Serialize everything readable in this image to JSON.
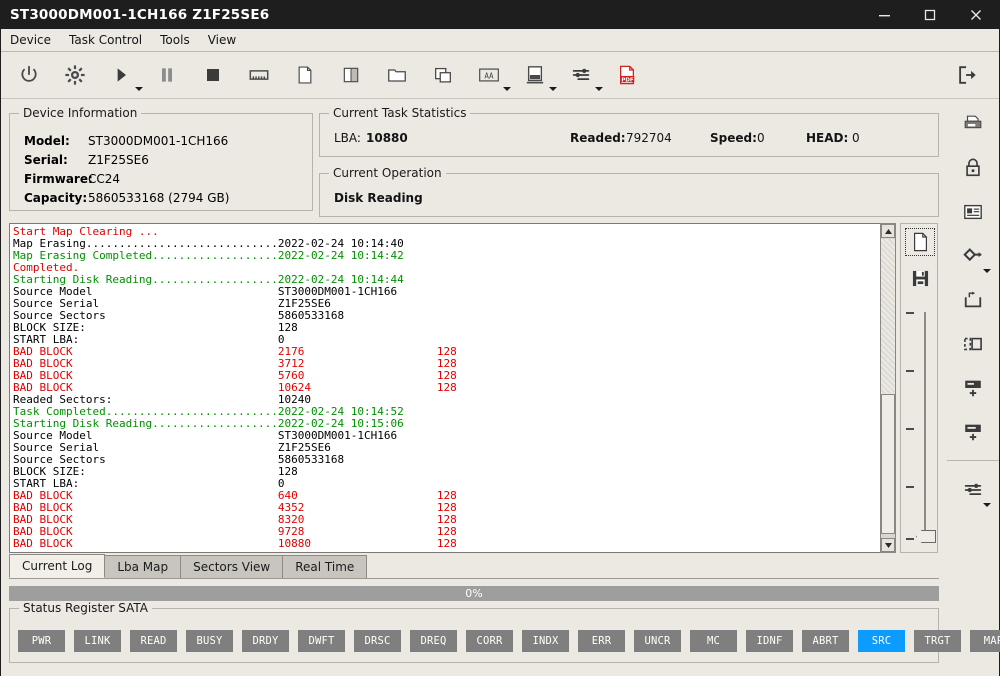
{
  "window": {
    "title": "ST3000DM001-1CH166 Z1F25SE6",
    "minimize": "minimize-icon",
    "maximize": "maximize-icon",
    "close": "close-icon"
  },
  "menu": {
    "items": [
      {
        "label": "Device"
      },
      {
        "label": "Task Control"
      },
      {
        "label": "Tools"
      },
      {
        "label": "View"
      }
    ]
  },
  "toolbar": {
    "buttons": [
      {
        "name": "power-icon",
        "caret": false
      },
      {
        "name": "gear-icon",
        "caret": false
      },
      {
        "name": "play-icon",
        "caret": true
      },
      {
        "name": "pause-icon",
        "caret": false
      },
      {
        "name": "stop-icon",
        "caret": false
      },
      {
        "name": "memory-chip-icon",
        "caret": false
      },
      {
        "name": "file-icon",
        "caret": false
      },
      {
        "name": "split-view-icon",
        "caret": false
      },
      {
        "name": "folder-icon",
        "caret": false
      },
      {
        "name": "copy-icon",
        "caret": false
      },
      {
        "name": "ascii-icon",
        "caret": true
      },
      {
        "name": "drive-icon",
        "caret": true
      },
      {
        "name": "sliders-icon",
        "caret": true
      },
      {
        "name": "pdf-icon",
        "caret": false
      }
    ],
    "exit": {
      "name": "exit-icon"
    }
  },
  "rail": {
    "buttons": [
      {
        "name": "print-icon",
        "caret": false
      },
      {
        "name": "lock-icon",
        "caret": false
      },
      {
        "name": "id-card-icon",
        "caret": false
      },
      {
        "name": "key-icon",
        "caret": true
      },
      {
        "name": "open-box-icon",
        "caret": false
      },
      {
        "name": "dashed-box-icon",
        "caret": false
      },
      {
        "name": "add-partition-icon",
        "caret": false
      },
      {
        "name": "add-bar-icon",
        "caret": false
      }
    ],
    "buttons_after_divider": [
      {
        "name": "sliders-icon",
        "caret": true
      }
    ]
  },
  "device_information": {
    "legend": "Device Information",
    "rows": [
      {
        "label": "Model:",
        "value": "ST3000DM001-1CH166"
      },
      {
        "label": "Serial:",
        "value": "Z1F25SE6"
      },
      {
        "label": "Firmware:",
        "value": "CC24"
      },
      {
        "label": "Capacity:",
        "value": "5860533168 (2794 GB)"
      }
    ]
  },
  "task_statistics": {
    "legend": "Current Task Statistics",
    "fields": [
      {
        "label": "LBA:",
        "value": "10880"
      },
      {
        "label": "Readed:",
        "value": "792704"
      },
      {
        "label": "Speed:",
        "value": "0"
      },
      {
        "label": "HEAD:",
        "value": "0"
      }
    ]
  },
  "current_operation": {
    "legend": "Current Operation",
    "value": "Disk Reading"
  },
  "log": {
    "lines": [
      {
        "color": "red",
        "text": "Start Map Clearing ..."
      },
      {
        "color": "black",
        "text": "Map Erasing.............................2022-02-24 10:14:40"
      },
      {
        "color": "green",
        "text": "Map Erasing Completed...................2022-02-24 10:14:42"
      },
      {
        "color": "red",
        "text": "Completed."
      },
      {
        "color": "green",
        "text": "Starting Disk Reading...................2022-02-24 10:14:44"
      },
      {
        "color": "black",
        "text": "Source Model                            ST3000DM001-1CH166"
      },
      {
        "color": "black",
        "text": "Source Serial                           Z1F25SE6"
      },
      {
        "color": "black",
        "text": "Source Sectors                          5860533168"
      },
      {
        "color": "black",
        "text": "BLOCK SIZE:                             128"
      },
      {
        "color": "black",
        "text": "START LBA:                              0"
      },
      {
        "color": "red",
        "text": "BAD BLOCK                               2176                    128"
      },
      {
        "color": "red",
        "text": "BAD BLOCK                               3712                    128"
      },
      {
        "color": "red",
        "text": "BAD BLOCK                               5760                    128"
      },
      {
        "color": "red",
        "text": "BAD BLOCK                               10624                   128"
      },
      {
        "color": "black",
        "text": "Readed Sectors:                         10240"
      },
      {
        "color": "green",
        "text": "Task Completed..........................2022-02-24 10:14:52"
      },
      {
        "color": "green",
        "text": "Starting Disk Reading...................2022-02-24 10:15:06"
      },
      {
        "color": "black",
        "text": "Source Model                            ST3000DM001-1CH166"
      },
      {
        "color": "black",
        "text": "Source Serial                           Z1F25SE6"
      },
      {
        "color": "black",
        "text": "Source Sectors                          5860533168"
      },
      {
        "color": "black",
        "text": "BLOCK SIZE:                             128"
      },
      {
        "color": "black",
        "text": "START LBA:                              0"
      },
      {
        "color": "red",
        "text": "BAD BLOCK                               640                     128"
      },
      {
        "color": "red",
        "text": "BAD BLOCK                               4352                    128"
      },
      {
        "color": "red",
        "text": "BAD BLOCK                               8320                    128"
      },
      {
        "color": "red",
        "text": "BAD BLOCK                               9728                    128"
      },
      {
        "color": "red",
        "text": "BAD BLOCK                               10880                   128"
      }
    ],
    "side_tools": [
      {
        "name": "new-log-icon",
        "selected": true
      },
      {
        "name": "save-log-icon",
        "selected": false
      }
    ],
    "scrollbar": {
      "up": "scroll-up-icon",
      "down": "scroll-down-icon"
    }
  },
  "tabs": {
    "items": [
      {
        "label": "Current Log",
        "active": true
      },
      {
        "label": "Lba Map",
        "active": false
      },
      {
        "label": "Sectors View",
        "active": false
      },
      {
        "label": "Real Time",
        "active": false
      }
    ]
  },
  "progress": {
    "percent_label": "0%",
    "value": 0
  },
  "status_register": {
    "legend": "Status Register SATA",
    "flags": [
      {
        "label": "PWR",
        "on": false
      },
      {
        "label": "LINK",
        "on": false
      },
      {
        "label": "READ",
        "on": false
      },
      {
        "label": "BUSY",
        "on": false
      },
      {
        "label": "DRDY",
        "on": false
      },
      {
        "label": "DWFT",
        "on": false
      },
      {
        "label": "DRSC",
        "on": false
      },
      {
        "label": "DREQ",
        "on": false
      },
      {
        "label": "CORR",
        "on": false
      },
      {
        "label": "INDX",
        "on": false
      },
      {
        "label": "ERR",
        "on": false
      },
      {
        "label": "UNCR",
        "on": false
      },
      {
        "label": "MC",
        "on": false
      },
      {
        "label": "IDNF",
        "on": false
      },
      {
        "label": "ABRT",
        "on": false
      },
      {
        "label": "SRC",
        "on": true
      },
      {
        "label": "TRGT",
        "on": false
      },
      {
        "label": "MAP",
        "on": false
      }
    ]
  },
  "colors": {
    "titlebar_bg": "#1e1e1e",
    "window_bg": "#ece9e3",
    "log_red": "#e00000",
    "log_green": "#009000",
    "flag_off": "#7f7f7f",
    "flag_on": "#0c9bff",
    "progress_bg": "#9e9e9e",
    "pdf_red": "#d32020"
  }
}
